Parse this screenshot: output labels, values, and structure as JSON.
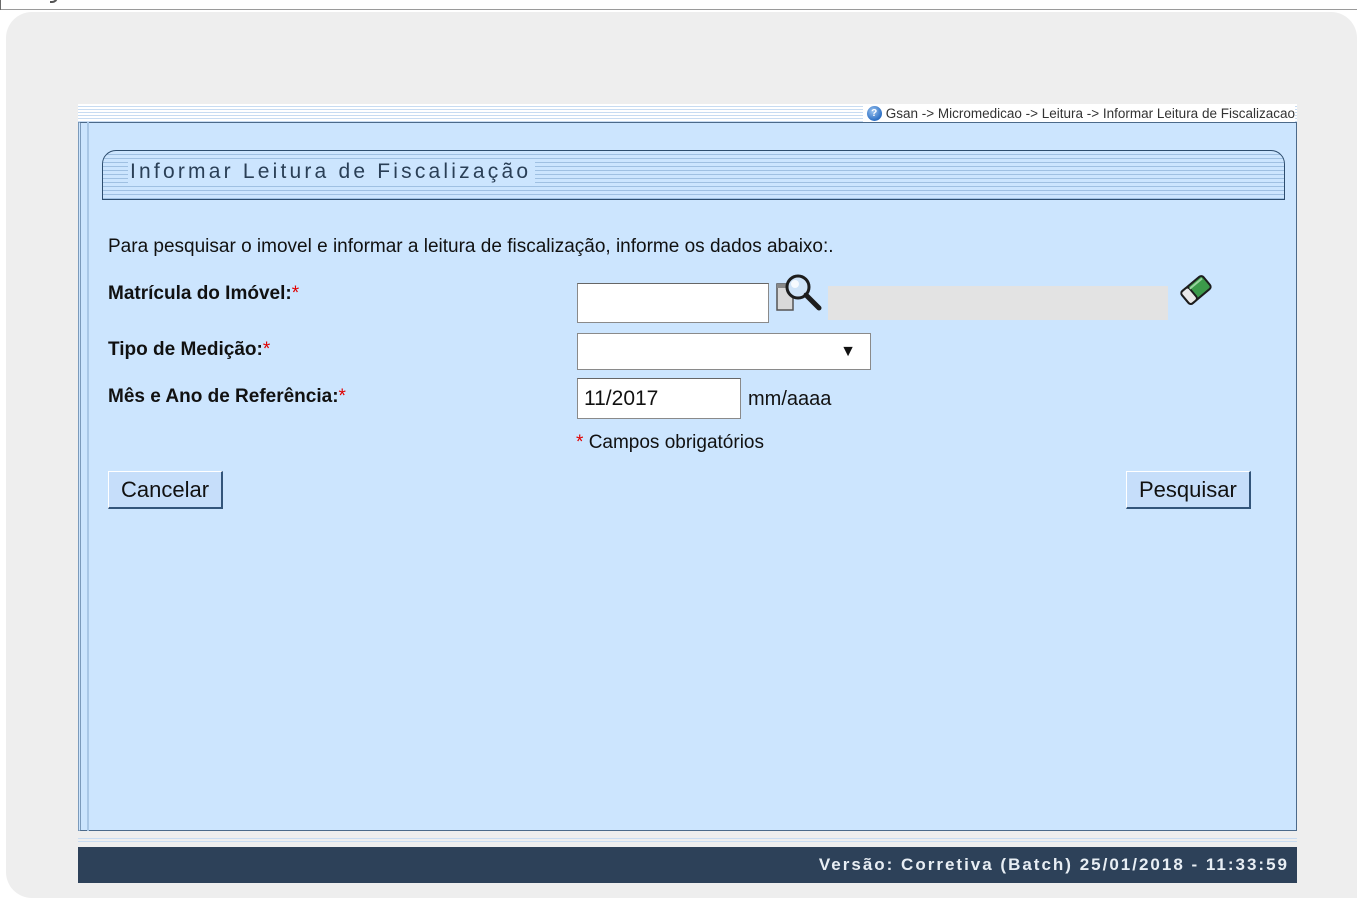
{
  "breadcrumb": {
    "path": "Gsan -> Micromedicao -> Leitura -> Informar Leitura de Fiscalizacao"
  },
  "form": {
    "title": "Informar Leitura de Fiscalização",
    "intro": "Para pesquisar o imovel e informar a leitura de fiscalização, informe os dados abaixo:.",
    "fields": [
      {
        "label": "Matrícula do Imóvel:",
        "required_mark": "*",
        "value": ""
      },
      {
        "label": "Tipo de Medição:",
        "required_mark": "*",
        "value": ""
      },
      {
        "label": "Mês e Ano de Referência:",
        "required_mark": "*",
        "value": "11/2017",
        "unit": "mm/aaaa"
      }
    ],
    "required_mark": "*",
    "required_note": "Campos obrigatórios",
    "cancel_label": "Cancelar",
    "search_label": "Pesquisar"
  },
  "footer": {
    "version": "Versão: Corretiva (Batch) 25/01/2018 - 11:33:59"
  },
  "icons": {
    "help": "help-icon",
    "lookup": "search-icon",
    "clear": "eraser-icon",
    "dropdown": "chevron-down-icon"
  },
  "colors": {
    "panel": "#cce5fe",
    "footer": "#2d4159",
    "required": "#e00000",
    "button": "#c6defa"
  }
}
